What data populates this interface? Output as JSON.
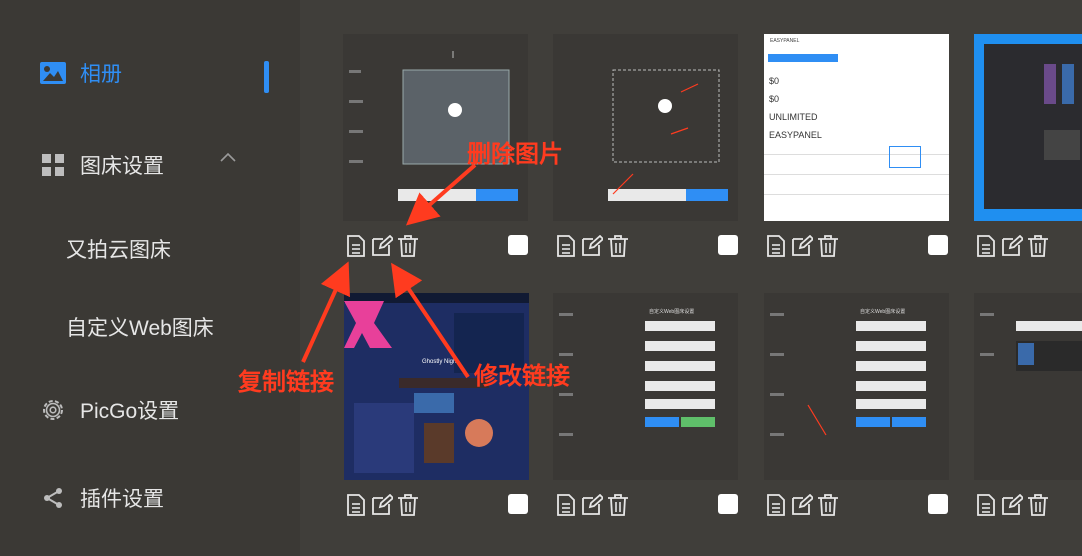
{
  "sidebar": {
    "items": [
      {
        "label": "相册",
        "icon": "image-icon"
      },
      {
        "label": "图床设置",
        "icon": "grid-icon"
      },
      {
        "label": "又拍云图床"
      },
      {
        "label": "自定义Web图床"
      },
      {
        "label": "PicGo设置",
        "icon": "gear-icon"
      },
      {
        "label": "插件设置",
        "icon": "share-icon"
      }
    ]
  },
  "annotations": {
    "delete": "删除图片",
    "copy": "复制链接",
    "edit": "修改链接"
  },
  "thumbs": {
    "t3": {
      "header": "EASYPANEL",
      "price1": "$0",
      "price2": "$0",
      "plan1": "UNLIMITED",
      "plan2": "EASYPANEL"
    },
    "t5_title": "Ghostly Night",
    "form_title": "自定义Web图床设置"
  },
  "colors": {
    "accent": "#2f8ef4",
    "annotation": "#ff3b1f"
  }
}
